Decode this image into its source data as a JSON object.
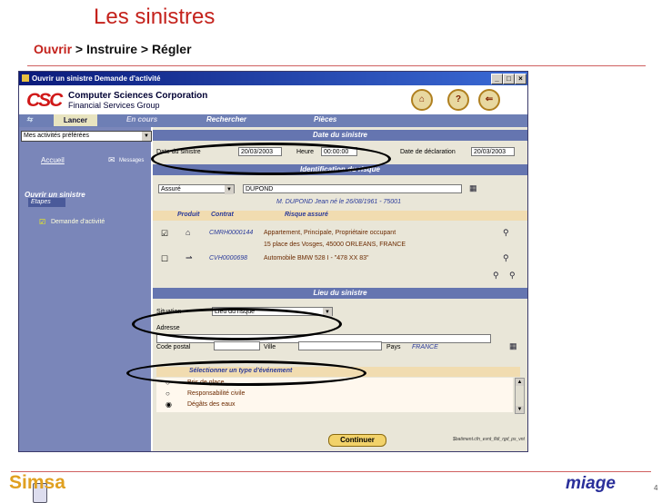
{
  "slide": {
    "title": "Les sinistres",
    "breadcrumb_first": "Ouvrir",
    "breadcrumb_rest": " > Instruire > Régler",
    "footer_left": "Simsa",
    "footer_right": "miage",
    "page_number": "4"
  },
  "window": {
    "title": "Ouvrir un sinistre Demande d'activité",
    "controls": [
      "_",
      "□",
      "×"
    ],
    "logo": "CSC",
    "company": "Computer Sciences Corporation",
    "company_sub": "Financial Services Group"
  },
  "nav": {
    "lancer": "Lancer",
    "en_cours": "En cours",
    "rechercher": "Rechercher",
    "pieces": "Pièces"
  },
  "sidebar": {
    "activities_select": "Mes activités préférées",
    "accueil": "Accueil",
    "messages": "Messages",
    "ouvrir": "Ouvrir un sinistre",
    "etapes": "Etapes",
    "demande": "Demande d'activité"
  },
  "date": {
    "section": "Date du sinistre",
    "date_label": "Date du sinistre",
    "date_value": "20/03/2003",
    "heure_label": "Heure",
    "heure_value": "00:00:00",
    "decl_label": "Date de déclaration",
    "decl_value": "20/03/2003"
  },
  "risque": {
    "section": "Identification du risque",
    "type_value": "Assuré",
    "name_value": "DUPOND",
    "person_info": "M. DUPOND Jean né le 26/08/1961 - 75001",
    "col_produit": "Produit",
    "col_contrat": "Contrat",
    "col_risque": "Risque assuré",
    "rows": [
      {
        "check": "☑",
        "contrat": "CMRH0000144",
        "line1": "Appartement, Principale, Propriétaire occupant",
        "line2": "15 place des Vosges, 45000 ORLEANS, FRANCE"
      },
      {
        "check": "☐",
        "contrat": "CVH0000698",
        "line1": "Automobile  BMW  528  I - \"478 XX 83\"",
        "line2": ""
      }
    ]
  },
  "lieu": {
    "section": "Lieu du sinistre",
    "situation_label": "Situation",
    "situation_value": "Lieu du risque",
    "adresse_label": "Adresse",
    "cp_label": "Code postal",
    "ville_label": "Ville",
    "pays_label": "Pays",
    "pays_value": "FRANCE"
  },
  "evenement": {
    "section": "Sélectionner un type d'événement",
    "options": [
      {
        "radio": "○",
        "label": "Bris de glace"
      },
      {
        "radio": "○",
        "label": "Responsabilité civile"
      },
      {
        "radio": "◉",
        "label": "Dégâts des eaux"
      }
    ]
  },
  "actions": {
    "continuer": "Continuer",
    "path": "$batiment.cfn_evnt_fldi_rgd_ps_vnt"
  }
}
